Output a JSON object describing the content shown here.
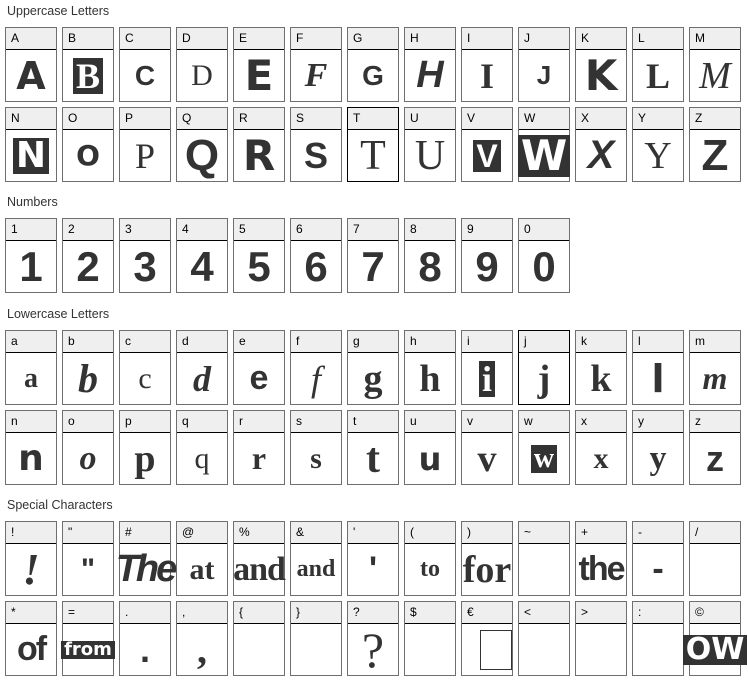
{
  "sections": [
    {
      "title": "Uppercase Letters",
      "cells": [
        {
          "label": "A",
          "glyph": "A"
        },
        {
          "label": "B",
          "glyph": "B"
        },
        {
          "label": "C",
          "glyph": "C"
        },
        {
          "label": "D",
          "glyph": "D"
        },
        {
          "label": "E",
          "glyph": "E"
        },
        {
          "label": "F",
          "glyph": "F"
        },
        {
          "label": "G",
          "glyph": "G"
        },
        {
          "label": "H",
          "glyph": "H"
        },
        {
          "label": "I",
          "glyph": "I"
        },
        {
          "label": "J",
          "glyph": "J"
        },
        {
          "label": "K",
          "glyph": "K"
        },
        {
          "label": "L",
          "glyph": "L"
        },
        {
          "label": "M",
          "glyph": "M"
        },
        {
          "label": "N",
          "glyph": "N"
        },
        {
          "label": "O",
          "glyph": "O"
        },
        {
          "label": "P",
          "glyph": "P"
        },
        {
          "label": "Q",
          "glyph": "Q"
        },
        {
          "label": "R",
          "glyph": "R"
        },
        {
          "label": "S",
          "glyph": "S"
        },
        {
          "label": "T",
          "glyph": "T",
          "active": true
        },
        {
          "label": "U",
          "glyph": "U"
        },
        {
          "label": "V",
          "glyph": "V"
        },
        {
          "label": "W",
          "glyph": "W"
        },
        {
          "label": "X",
          "glyph": "X"
        },
        {
          "label": "Y",
          "glyph": "Y"
        },
        {
          "label": "Z",
          "glyph": "Z"
        }
      ]
    },
    {
      "title": "Numbers",
      "cells": [
        {
          "label": "1",
          "glyph": "1"
        },
        {
          "label": "2",
          "glyph": "2"
        },
        {
          "label": "3",
          "glyph": "3"
        },
        {
          "label": "4",
          "glyph": "4"
        },
        {
          "label": "5",
          "glyph": "5"
        },
        {
          "label": "6",
          "glyph": "6"
        },
        {
          "label": "7",
          "glyph": "7"
        },
        {
          "label": "8",
          "glyph": "8"
        },
        {
          "label": "9",
          "glyph": "9"
        },
        {
          "label": "0",
          "glyph": "0"
        }
      ]
    },
    {
      "title": "Lowercase Letters",
      "cells": [
        {
          "label": "a",
          "glyph": "a"
        },
        {
          "label": "b",
          "glyph": "b"
        },
        {
          "label": "c",
          "glyph": "c"
        },
        {
          "label": "d",
          "glyph": "d"
        },
        {
          "label": "e",
          "glyph": "e"
        },
        {
          "label": "f",
          "glyph": "f"
        },
        {
          "label": "g",
          "glyph": "g"
        },
        {
          "label": "h",
          "glyph": "h"
        },
        {
          "label": "i",
          "glyph": "i"
        },
        {
          "label": "j",
          "glyph": "j",
          "active": true
        },
        {
          "label": "k",
          "glyph": "k"
        },
        {
          "label": "l",
          "glyph": "l"
        },
        {
          "label": "m",
          "glyph": "m"
        },
        {
          "label": "n",
          "glyph": "n"
        },
        {
          "label": "o",
          "glyph": "o"
        },
        {
          "label": "p",
          "glyph": "p"
        },
        {
          "label": "q",
          "glyph": "q"
        },
        {
          "label": "r",
          "glyph": "r"
        },
        {
          "label": "s",
          "glyph": "s"
        },
        {
          "label": "t",
          "glyph": "t"
        },
        {
          "label": "u",
          "glyph": "u"
        },
        {
          "label": "v",
          "glyph": "v"
        },
        {
          "label": "w",
          "glyph": "w"
        },
        {
          "label": "x",
          "glyph": "x"
        },
        {
          "label": "y",
          "glyph": "y"
        },
        {
          "label": "z",
          "glyph": "z"
        }
      ]
    },
    {
      "title": "Special Characters",
      "cells": [
        {
          "label": "!",
          "glyph": "!"
        },
        {
          "label": "\"",
          "glyph": "\""
        },
        {
          "label": "#",
          "glyph": "The"
        },
        {
          "label": "@",
          "glyph": "at"
        },
        {
          "label": "%",
          "glyph": "and"
        },
        {
          "label": "&",
          "glyph": "and"
        },
        {
          "label": "'",
          "glyph": "'"
        },
        {
          "label": "(",
          "glyph": "to"
        },
        {
          "label": ")",
          "glyph": "for"
        },
        {
          "label": "~",
          "glyph": ""
        },
        {
          "label": "+",
          "glyph": "the"
        },
        {
          "label": "-",
          "glyph": "-"
        },
        {
          "label": "/",
          "glyph": ""
        },
        {
          "label": "*",
          "glyph": "of"
        },
        {
          "label": "=",
          "glyph": "from"
        },
        {
          "label": ".",
          "glyph": "."
        },
        {
          "label": ",",
          "glyph": ","
        },
        {
          "label": "{",
          "glyph": ""
        },
        {
          "label": "}",
          "glyph": ""
        },
        {
          "label": "?",
          "glyph": "?"
        },
        {
          "label": "$",
          "glyph": ""
        },
        {
          "label": "€",
          "glyph": "",
          "missing": true
        },
        {
          "label": "<",
          "glyph": ""
        },
        {
          "label": ">",
          "glyph": ""
        },
        {
          "label": ":",
          "glyph": ""
        },
        {
          "label": "©",
          "glyph": "OW"
        }
      ]
    }
  ]
}
